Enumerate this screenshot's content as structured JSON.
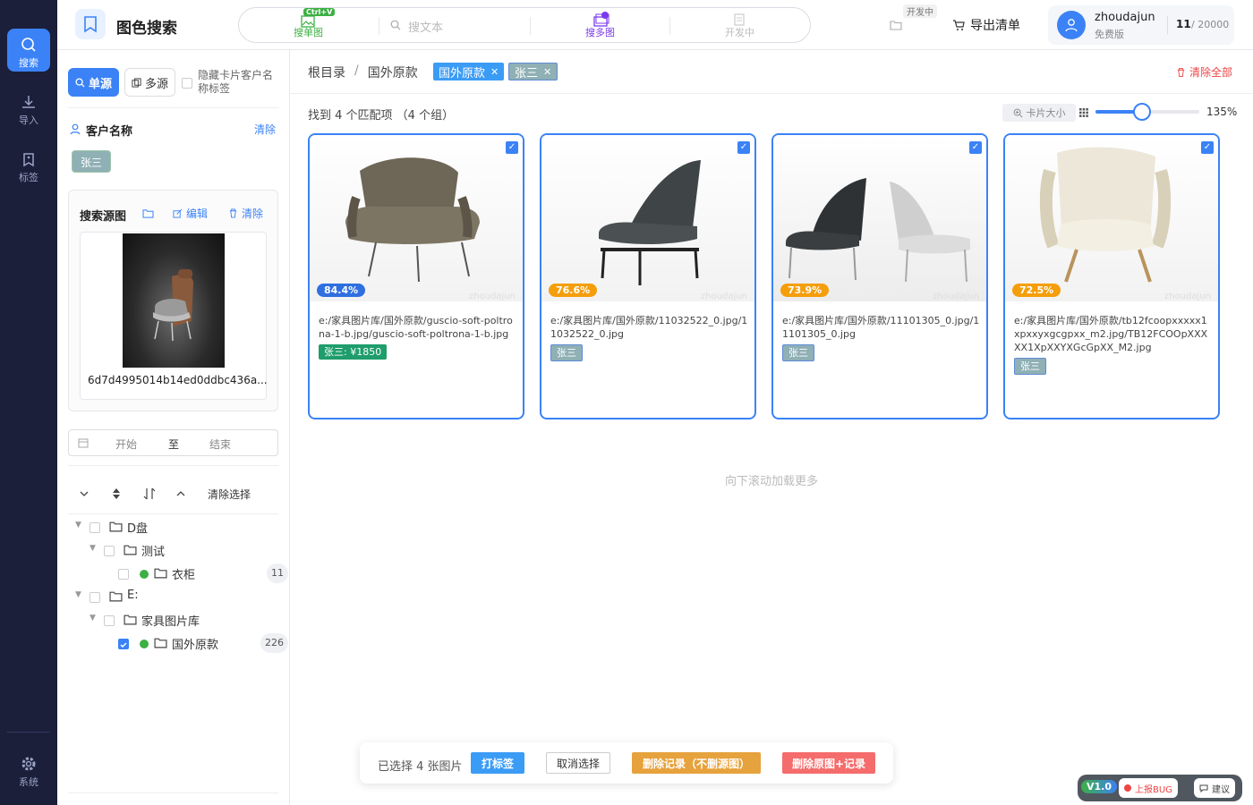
{
  "rail": {
    "search": "搜索",
    "import": "导入",
    "tags": "标签",
    "system": "系统"
  },
  "header": {
    "title": "图色搜索",
    "modes": {
      "single_badge": "Ctrl+V",
      "single": "搜单图",
      "text_placeholder": "搜文本",
      "multi": "搜多图",
      "dev": "开发中"
    },
    "folder_dev": "开发中",
    "export": "导出清单",
    "user": {
      "name": "zhoudajun",
      "plan": "免费版",
      "used": "11",
      "quota": "/ 20000"
    }
  },
  "sidebar": {
    "single_source": "单源",
    "multi_source": "多源",
    "hide_label": "隐藏卡片客户名称标签",
    "customer_title": "客户名称",
    "customer_clear": "清除",
    "customer_tag": "张三",
    "source": {
      "title": "搜索源图",
      "edit": "编辑",
      "clear": "清除",
      "hash": "6d7d4995014b14ed0ddbc436a..."
    },
    "date": {
      "start": "开始",
      "to": "至",
      "end": "结束"
    },
    "clear_selection": "清除选择",
    "tree": [
      {
        "label": "D盘",
        "count": ""
      },
      {
        "label": "测试",
        "count": ""
      },
      {
        "label": "衣柜",
        "count": "11"
      },
      {
        "label": "E:",
        "count": ""
      },
      {
        "label": "家具图片库",
        "count": ""
      },
      {
        "label": "国外原款",
        "count": "226"
      }
    ]
  },
  "main": {
    "breadcrumb": {
      "root": "根目录",
      "sep": "/",
      "folder": "国外原款"
    },
    "filters": {
      "tag1": "国外原款",
      "tag2": "张三"
    },
    "clear_all": "清除全部",
    "summary": "找到 4 个匹配项 （4 个组）",
    "card_size": "卡片大小",
    "zoom": "135%",
    "zoom_level": 0.45,
    "load_more": "向下滚动加载更多",
    "cards": [
      {
        "score": "84.4%",
        "score_color": "#2f6fe0",
        "path": "e:/家具图片库/国外原款/guscio-soft-poltrona-1-b.jpg/guscio-soft-poltrona-1-b.jpg",
        "tag": "张三: ¥1850",
        "tag_color": "#1f9d6b",
        "watermark": "zhoudajun"
      },
      {
        "score": "76.6%",
        "score_color": "#f59e0b",
        "path": "e:/家具图片库/国外原款/11032522_0.jpg/11032522_0.jpg",
        "tag": "张三",
        "tag_color": "#8fb0b5",
        "watermark": "zhoudajun"
      },
      {
        "score": "73.9%",
        "score_color": "#f59e0b",
        "path": "e:/家具图片库/国外原款/11101305_0.jpg/11101305_0.jpg",
        "tag": "张三",
        "tag_color": "#8fb0b5",
        "watermark": "zhoudajun"
      },
      {
        "score": "72.5%",
        "score_color": "#f59e0b",
        "path": "e:/家具图片库/国外原款/tb12fcoopxxxxx1xpxxyxgcgpxx_m2.jpg/TB12FCOOpXXXXX1XpXXYXGcGpXX_M2.jpg",
        "tag": "张三",
        "tag_color": "#8fb0b5",
        "watermark": "zhoudajun"
      }
    ],
    "bottom_bar": {
      "selected": "已选择 4 张图片",
      "tag": "打标签",
      "cancel": "取消选择",
      "delete_record": "删除记录（不删源图）",
      "delete_all": "删除原图+记录"
    }
  },
  "footer": {
    "version": "V1.0",
    "bug": "上报BUG",
    "suggest": "建议"
  }
}
